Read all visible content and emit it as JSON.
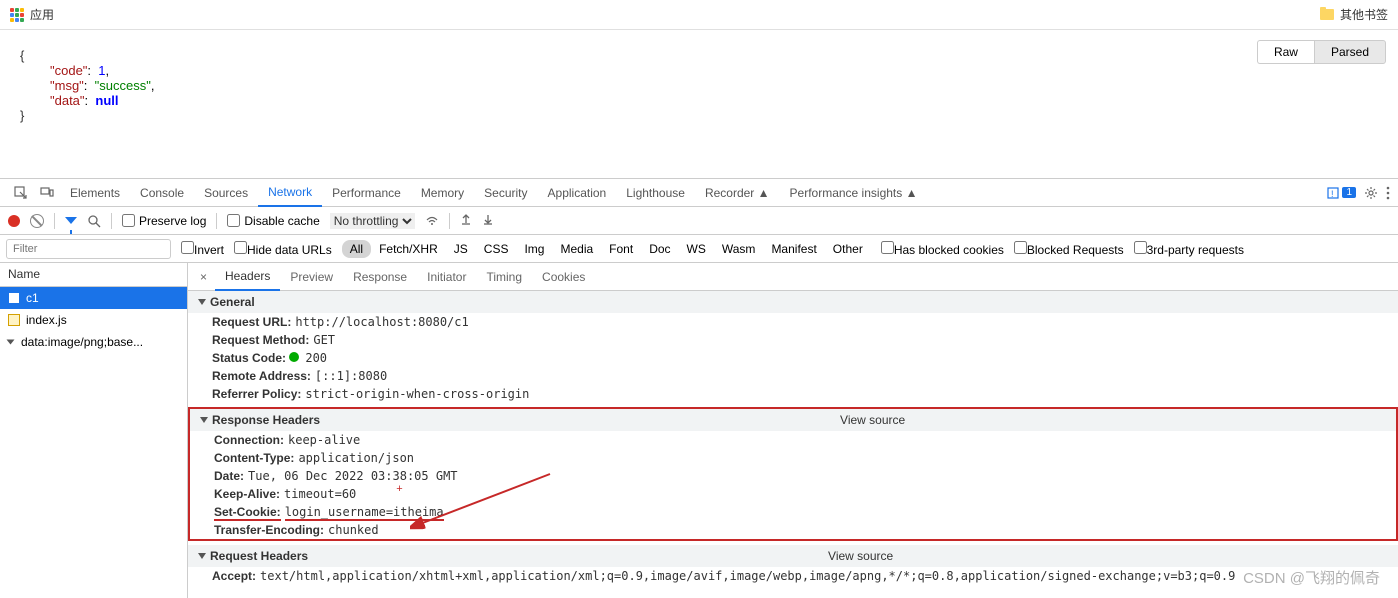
{
  "bookmarks": {
    "apps": "应用",
    "other": "其他书签"
  },
  "json": {
    "code_key": "\"code\"",
    "code_val": "1",
    "msg_key": "\"msg\"",
    "msg_val": "\"success\"",
    "data_key": "\"data\"",
    "data_val": "null",
    "raw_btn": "Raw",
    "parsed_btn": "Parsed"
  },
  "devtools_tabs": [
    "Elements",
    "Console",
    "Sources",
    "Network",
    "Performance",
    "Memory",
    "Security",
    "Application",
    "Lighthouse",
    "Recorder ▲",
    "Performance insights ▲"
  ],
  "devtools_active": "Network",
  "badge": "1",
  "toolbar": {
    "preserve": "Preserve log",
    "disable_cache": "Disable cache",
    "throttle": "No throttling"
  },
  "filterbar": {
    "placeholder": "Filter",
    "invert": "Invert",
    "hide_urls": "Hide data URLs",
    "types": [
      "All",
      "Fetch/XHR",
      "JS",
      "CSS",
      "Img",
      "Media",
      "Font",
      "Doc",
      "WS",
      "Wasm",
      "Manifest",
      "Other"
    ],
    "blocked_cookies": "Has blocked cookies",
    "blocked_req": "Blocked Requests",
    "third_party": "3rd-party requests"
  },
  "sidebar": {
    "name_hd": "Name",
    "items": [
      {
        "label": "c1",
        "type": "doc",
        "selected": true
      },
      {
        "label": "index.js",
        "type": "js",
        "selected": false
      },
      {
        "label": "data:image/png;base...",
        "type": "tree",
        "selected": false
      }
    ]
  },
  "detail_tabs": [
    "Headers",
    "Preview",
    "Response",
    "Initiator",
    "Timing",
    "Cookies"
  ],
  "detail_active": "Headers",
  "sections": {
    "general": {
      "title": "General",
      "request_url_lbl": "Request URL:",
      "request_url": "http://localhost:8080/c1",
      "method_lbl": "Request Method:",
      "method": "GET",
      "status_lbl": "Status Code:",
      "status": "200",
      "remote_lbl": "Remote Address:",
      "remote": "[::1]:8080",
      "ref_lbl": "Referrer Policy:",
      "ref": "strict-origin-when-cross-origin"
    },
    "response_headers": {
      "title": "Response Headers",
      "view_source": "View source",
      "conn_lbl": "Connection:",
      "conn": "keep-alive",
      "ct_lbl": "Content-Type:",
      "ct": "application/json",
      "date_lbl": "Date:",
      "date": "Tue, 06 Dec 2022 03:38:05 GMT",
      "ka_lbl": "Keep-Alive:",
      "ka": "timeout=60",
      "cookie_lbl": "Set-Cookie:",
      "cookie": "login_username=itheima",
      "te_lbl": "Transfer-Encoding:",
      "te": "chunked"
    },
    "request_headers": {
      "title": "Request Headers",
      "view_source": "View source",
      "accept_lbl": "Accept:",
      "accept": "text/html,application/xhtml+xml,application/xml;q=0.9,image/avif,image/webp,image/apng,*/*;q=0.8,application/signed-exchange;v=b3;q=0.9"
    }
  },
  "watermark": "CSDN @飞翔的佩奇"
}
